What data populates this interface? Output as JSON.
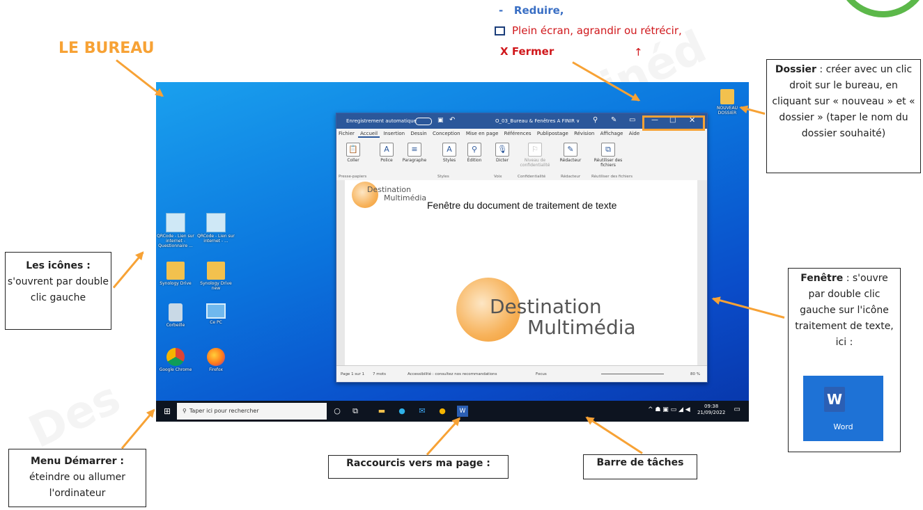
{
  "legend": {
    "reduce": "Reduire,",
    "reduce_prefix": "-",
    "fullscreen": "Plein écran, agrandir ou rétrécir,",
    "close_prefix": "X",
    "close": "Fermer",
    "up_arrow": "↑"
  },
  "desktop_title": "LE BUREAU",
  "desktop_icons": [
    {
      "label": "QRCode - Lien sur internet - Questionnaire ..."
    },
    {
      "label": "QRCode - Lien sur internet - ..."
    },
    {
      "label": "Synology Drive"
    },
    {
      "label": "Synology Drive new"
    },
    {
      "label": "Corbeille"
    },
    {
      "label": "Ce PC"
    },
    {
      "label": "Google Chrome"
    },
    {
      "label": "Firefox"
    }
  ],
  "folder_icon": {
    "label": "NOUVEAU DOSSIER"
  },
  "word_window": {
    "autosave": "Enregistrement automatique",
    "doc_title": "O_03_Bureau & Fenêtres A FINIR ∨",
    "menu": [
      "Fichier",
      "Accueil",
      "Insertion",
      "Dessin",
      "Conception",
      "Mise en page",
      "Références",
      "Publipostage",
      "Révision",
      "Affichage",
      "Aide"
    ],
    "ribbon": {
      "coller": "Coller",
      "police": "Police",
      "paragraphe": "Paragraphe",
      "styles": "Styles",
      "edition": "Édition",
      "dicter": "Dicter",
      "niveau": "Niveau de confidentialité",
      "redacteur": "Rédacteur",
      "reutiliser": "Réutiliser des fichiers",
      "grp_presse": "Presse-papiers",
      "grp_styles": "Styles",
      "grp_voix": "Voix",
      "grp_confid": "Confidentialité",
      "grp_redacteur": "Rédacteur",
      "grp_reutiliser": "Réutiliser des fichiers"
    },
    "doc_heading": "Fenêtre du document de traitement de texte",
    "brand_line1": "Destination",
    "brand_line2": "Multimédia",
    "status": {
      "page": "Page 1 sur 1",
      "words": "7 mots",
      "accessibility": "Accessibilité : consultez nos recommandations",
      "focus": "Focus",
      "zoom": "80 %"
    }
  },
  "taskbar": {
    "search_placeholder": "Taper ici pour rechercher",
    "time": "09:38",
    "date": "21/09/2022"
  },
  "notes": {
    "icones_title": "Les icônes :",
    "icones_text": "s'ouvrent par double clic gauche",
    "menu_title": "Menu Démarrer :",
    "menu_text": "éteindre ou allumer l'ordinateur",
    "raccourcis": "Raccourcis vers ma page :",
    "barre": "Barre de tâches",
    "dossier_title": "Dossier",
    "dossier_text": " : créer avec un clic droit sur le bureau, en cliquant sur « nouveau » et « dossier » (taper le nom du dossier souhaité)",
    "fenetre_title": "Fenêtre",
    "fenetre_text": " : s'ouvre par double clic gauche sur l'icône traitement de texte, ici :",
    "word_label": "Word"
  },
  "colors": {
    "accent_orange": "#f7a235",
    "red": "#d0181c",
    "blue_text": "#3a6fc4"
  }
}
